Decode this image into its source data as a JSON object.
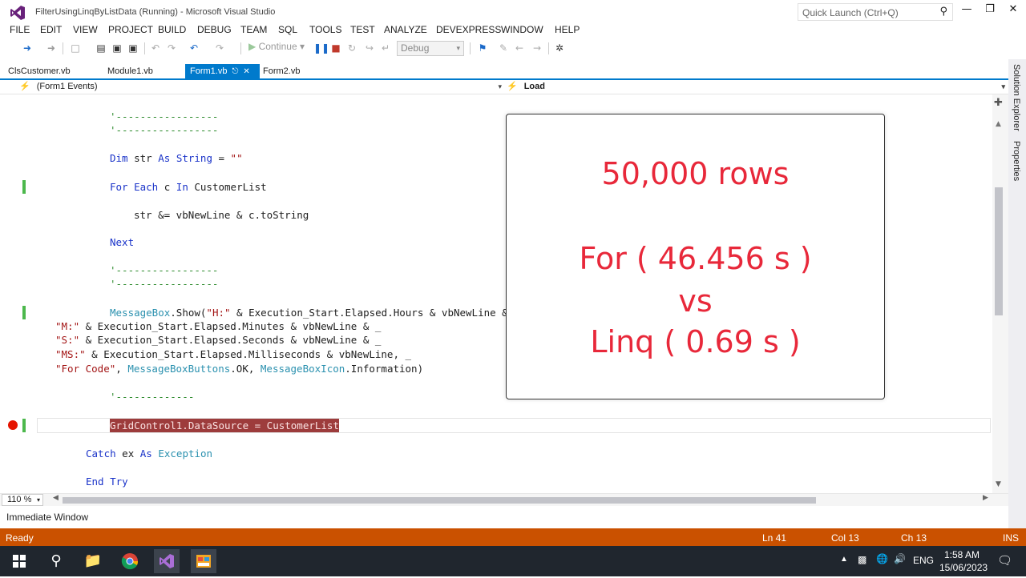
{
  "window": {
    "title": "FilterUsingLinqByListData (Running) - Microsoft Visual Studio",
    "quick_launch_placeholder": "Quick Launch (Ctrl+Q)"
  },
  "menu": [
    "FILE",
    "EDIT",
    "VIEW",
    "PROJECT",
    "BUILD",
    "DEBUG",
    "TEAM",
    "SQL",
    "TOOLS",
    "TEST",
    "ANALYZE",
    "DEVEXPRESS",
    "WINDOW",
    "HELP"
  ],
  "toolbar": {
    "continue_label": "Continue",
    "config_value": "Debug"
  },
  "tabs": [
    {
      "label": "ClsCustomer.vb",
      "active": false
    },
    {
      "label": "Module1.vb",
      "active": false
    },
    {
      "label": "Form1.vb",
      "active": true
    },
    {
      "label": "Form2.vb",
      "active": false
    }
  ],
  "nav": {
    "left": "(Form1 Events)",
    "right": "Load"
  },
  "code": {
    "comment_a": "'-----------------",
    "comment_b": "'-----------------",
    "dim_kw": "Dim",
    "dim_var": " str ",
    "as_kw": "As",
    "string_type": "String",
    "dim_eq": " = ",
    "dim_str": "\"\"",
    "for_kw": "For Each",
    "for_var": " c ",
    "in_kw": "In",
    "for_list": " CustomerList",
    "concat": "str &= vbNewLine & c.toString",
    "next_kw": "Next",
    "comment_c": "'-----------------",
    "comment_d": "'-----------------",
    "msg_type": "MessageBox",
    "msg_call": ".Show(",
    "msg_str_h": "\"H:\"",
    "msg_rest1": " & Execution_Start.Elapsed.Hours & vbNewLine &",
    "msg_str_m": "\"M:\"",
    "msg_rest2": " & Execution_Start.Elapsed.Minutes & vbNewLine & _",
    "msg_str_s": "\"S:\"",
    "msg_rest3": " & Execution_Start.Elapsed.Seconds & vbNewLine & _",
    "msg_str_ms": "\"MS:\"",
    "msg_rest4": " & Execution_Start.Elapsed.Milliseconds & vbNewLine, _",
    "msg_str_for": "\"For Code\"",
    "msg_sep": ", ",
    "msg_buttons_type": "MessageBoxButtons",
    "msg_ok": ".OK, ",
    "msg_icon_type": "MessageBoxIcon",
    "msg_info": ".Information)",
    "comment_e": "'-------------",
    "bp_line": "GridControl1.DataSource = CustomerList",
    "catch_kw": "Catch",
    "catch_var": " ex ",
    "catch_as": "As",
    "catch_type": " Exception",
    "end_try": "End Try"
  },
  "editor_footer": {
    "zoom": "110 %",
    "immediate_window": "Immediate Window"
  },
  "side_panel": {
    "solution_explorer": "Solution Explorer",
    "properties": "Properties"
  },
  "status": {
    "ready": "Ready",
    "ln": "Ln 41",
    "col": "Col 13",
    "ch": "Ch 13",
    "ins": "INS"
  },
  "taskbar": {
    "lang": "ENG",
    "time": "1:58 AM",
    "date": "15/06/2023"
  },
  "overlay": {
    "line1": "50,000 rows",
    "line2": "For ( 46.456 s )",
    "line3": "vs",
    "line4": "Linq ( 0.69 s )"
  },
  "colors": {
    "accent": "#007acc",
    "status_bar": "#ca5100",
    "overlay_text": "#e8283a",
    "breakpoint": "#e51400"
  }
}
